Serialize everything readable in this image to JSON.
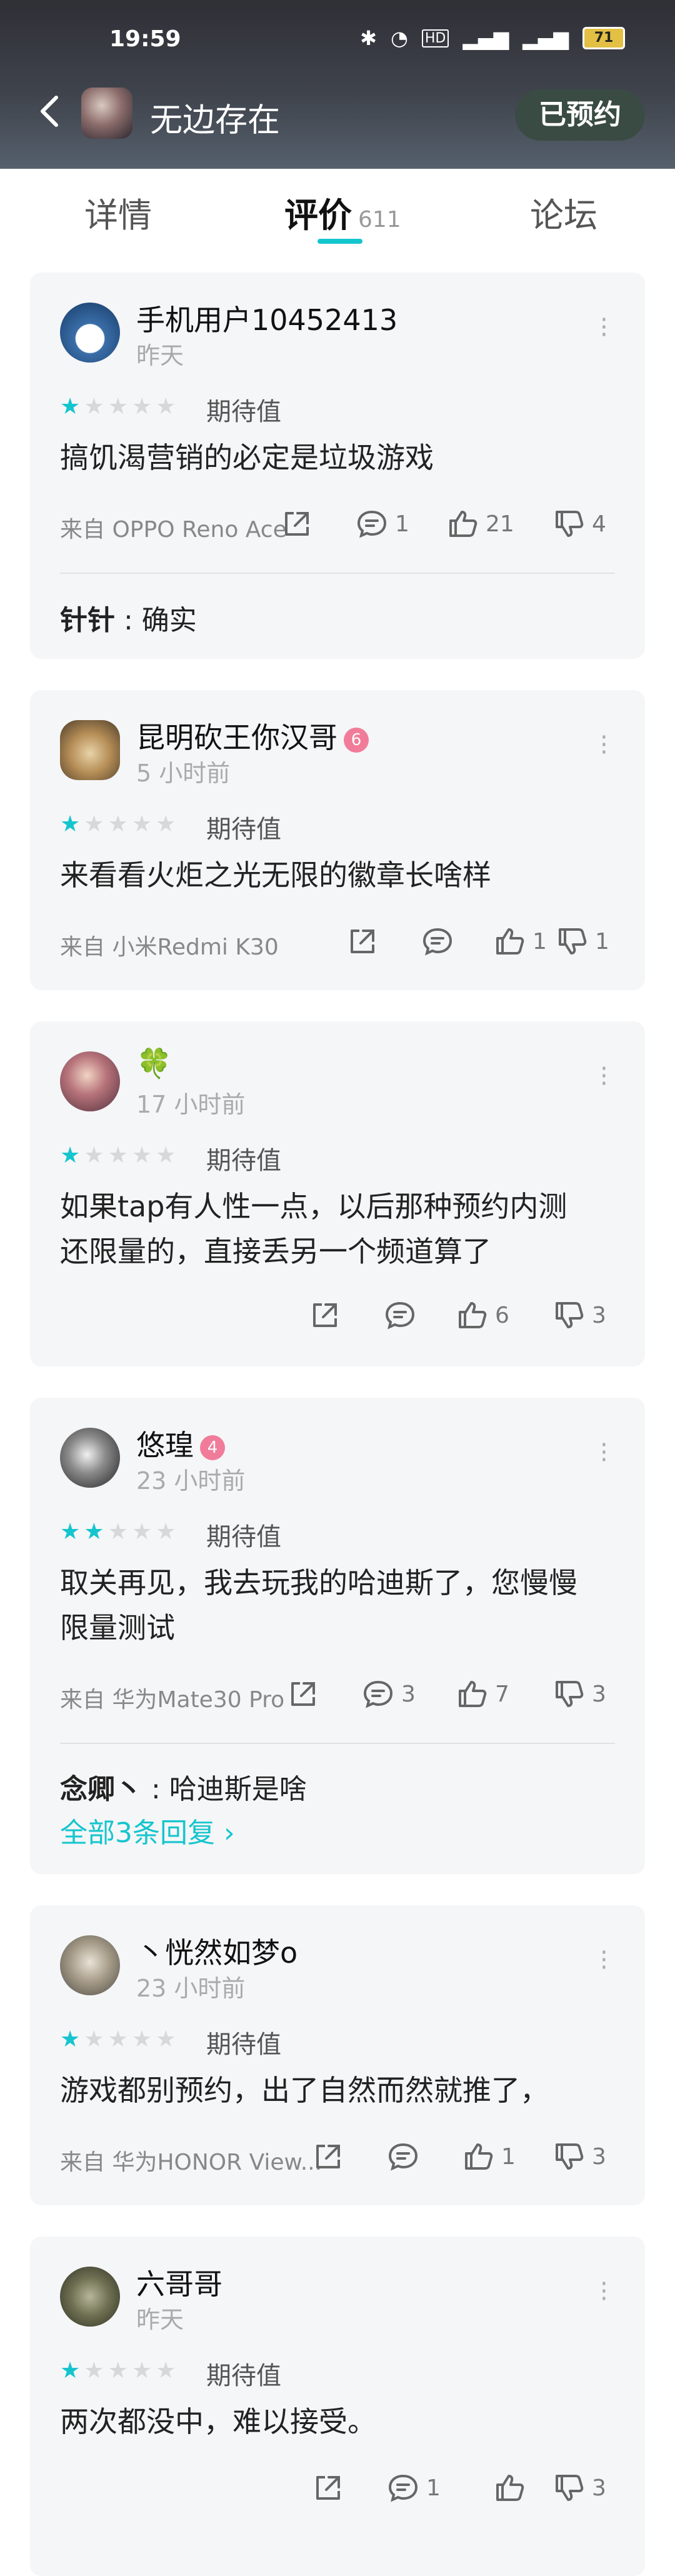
{
  "status_bar": {
    "time": "19:59",
    "battery": "71"
  },
  "header": {
    "title": "无边存在",
    "reserved_button": "已预约"
  },
  "tabs": [
    {
      "label": "详情"
    },
    {
      "label": "评价",
      "count": "611"
    },
    {
      "label": "论坛"
    }
  ],
  "colors": {
    "accent": "#15c5ce",
    "card_bg": "#f5f6f8",
    "badge": "#f07c9a"
  },
  "reviews": [
    {
      "user": "手机用户10452413",
      "time": "昨天",
      "stars": 1,
      "rating_label": "期待值",
      "text": "搞饥渴营销的必定是垃圾游戏",
      "device": "来自 OPPO Reno Ace",
      "comments": "1",
      "likes": "21",
      "dislikes": "4",
      "reply_user": "针针",
      "reply_text": " : 确实"
    },
    {
      "user": "昆明砍王你汉哥",
      "time": "5 小时前",
      "stars": 1,
      "rating_label": "期待值",
      "text": "来看看火炬之光无限的徽章长啥样",
      "device": "来自 小米Redmi K30",
      "comments": "",
      "likes": "1",
      "dislikes": "1"
    },
    {
      "user": "🍀",
      "time": "17 小时前",
      "stars": 1,
      "rating_label": "期待值",
      "text_line1": "如果tap有人性一点，以后那种预约内测",
      "text_line2": "还限量的，直接丢另一个频道算了",
      "comments": "",
      "likes": "6",
      "dislikes": "3"
    },
    {
      "user": "悠瑝",
      "badge": "4",
      "time": "23 小时前",
      "stars": 2,
      "rating_label": "期待值",
      "text_line1": "取关再见，我去玩我的哈迪斯了，您慢慢",
      "text_line2": "限量测试",
      "device": "来自 华为Mate30 Pro",
      "comments": "3",
      "likes": "7",
      "dislikes": "3",
      "reply_user": "念卿丶",
      "reply_text": " : 哈迪斯是啥",
      "all_replies": "全部3条回复 ›"
    },
    {
      "user": "丶恍然如梦o",
      "time": "23 小时前",
      "stars": 1,
      "rating_label": "期待值",
      "text": "游戏都别预约，出了自然而然就推了，",
      "device": "来自 华为HONOR View...",
      "comments": "",
      "likes": "1",
      "dislikes": "3"
    },
    {
      "user": "六哥哥",
      "time": "昨天",
      "stars": 1,
      "rating_label": "期待值",
      "text": "两次都没中，难以接受。",
      "comments": "1",
      "likes": "",
      "dislikes": "3"
    }
  ]
}
